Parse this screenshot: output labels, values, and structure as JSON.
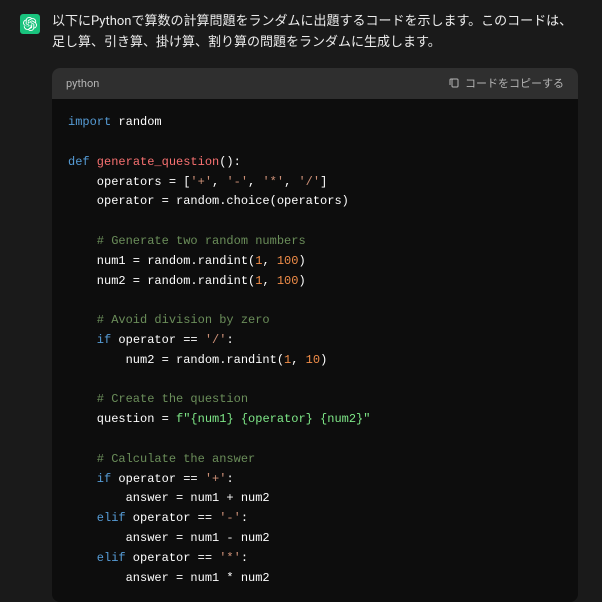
{
  "intro": "以下にPythonで算数の計算問題をランダムに出題するコードを示します。このコードは、足し算、引き算、掛け算、割り算の問題をランダムに生成します。",
  "code_header": {
    "language": "python",
    "copy_label": "コードをコピーする"
  },
  "code": {
    "l1_import": "import",
    "l1_mod": " random",
    "l3_def": "def",
    "l3_fn": " generate_question",
    "l3_rest": "():",
    "l4a": "    operators = [",
    "l4s1": "'+'",
    "l4c1": ", ",
    "l4s2": "'-'",
    "l4c2": ", ",
    "l4s3": "'*'",
    "l4c3": ", ",
    "l4s4": "'/'",
    "l4b": "]",
    "l5": "    operator = random.choice(operators)",
    "l7_comment": "    # Generate two random numbers",
    "l8a": "    num1 = random.randint(",
    "l8n1": "1",
    "l8c": ", ",
    "l8n2": "100",
    "l8b": ")",
    "l9a": "    num2 = random.randint(",
    "l9n1": "1",
    "l9c": ", ",
    "l9n2": "100",
    "l9b": ")",
    "l11_comment": "    # Avoid division by zero",
    "l12_if": "    if",
    "l12a": " operator == ",
    "l12s": "'/'",
    "l12b": ":",
    "l13a": "        num2 = random.randint(",
    "l13n1": "1",
    "l13c": ", ",
    "l13n2": "10",
    "l13b": ")",
    "l15_comment": "    # Create the question",
    "l16a": "    question = ",
    "l16f": "f\"{num1} {operator} {num2}\"",
    "l18_comment": "    # Calculate the answer",
    "l19_if": "    if",
    "l19a": " operator == ",
    "l19s": "'+'",
    "l19b": ":",
    "l20": "        answer = num1 + num2",
    "l21_elif": "    elif",
    "l21a": " operator == ",
    "l21s": "'-'",
    "l21b": ":",
    "l22": "        answer = num1 - num2",
    "l23_elif": "    elif",
    "l23a": " operator == ",
    "l23s": "'*'",
    "l23b": ":",
    "l24": "        answer = num1 * num2"
  }
}
